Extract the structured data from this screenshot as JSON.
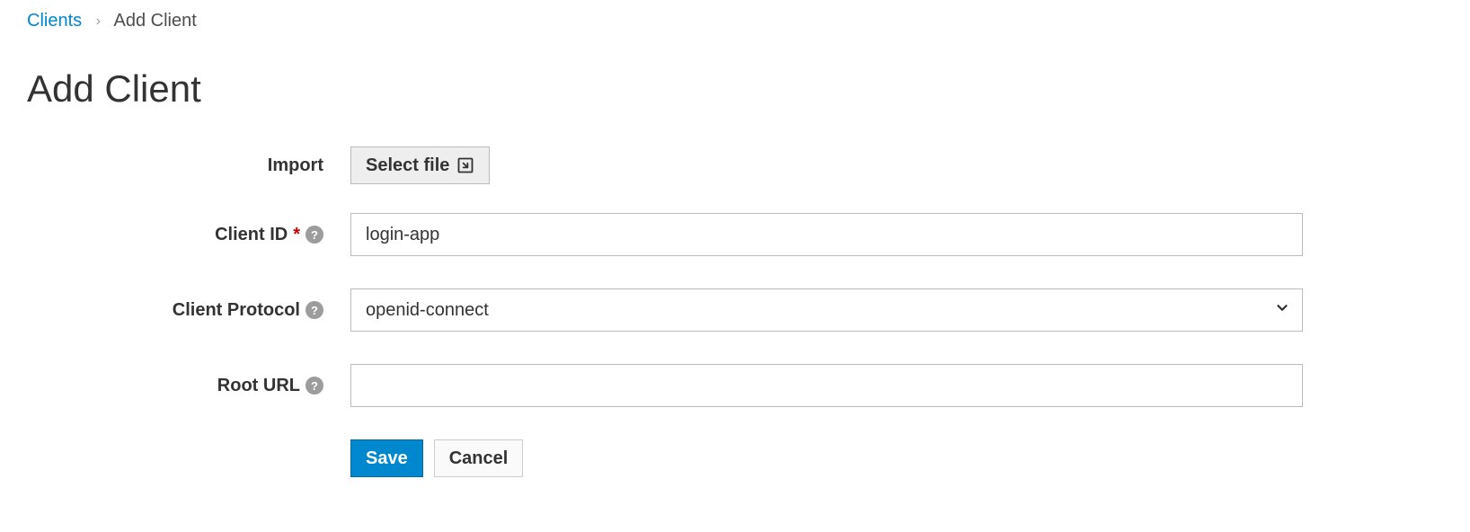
{
  "breadcrumb": {
    "parent": "Clients",
    "current": "Add Client"
  },
  "title": "Add Client",
  "form": {
    "import": {
      "label": "Import",
      "button": "Select file"
    },
    "client_id": {
      "label": "Client ID",
      "value": "login-app"
    },
    "client_protocol": {
      "label": "Client Protocol",
      "value": "openid-connect"
    },
    "root_url": {
      "label": "Root URL",
      "value": ""
    }
  },
  "actions": {
    "save": "Save",
    "cancel": "Cancel"
  }
}
